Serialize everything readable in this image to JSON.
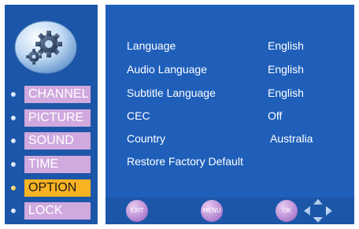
{
  "sidebar": {
    "items": [
      {
        "label": "CHANNEL",
        "active": false
      },
      {
        "label": "PICTURE",
        "active": false
      },
      {
        "label": "SOUND",
        "active": false
      },
      {
        "label": "TIME",
        "active": false
      },
      {
        "label": "OPTION",
        "active": true
      },
      {
        "label": "LOCK",
        "active": false
      }
    ]
  },
  "settings": [
    {
      "name": "Language",
      "value": "English"
    },
    {
      "name": "Audio Language",
      "value": "English"
    },
    {
      "name": "Subtitle Language",
      "value": "English"
    },
    {
      "name": "CEC",
      "value": "Off"
    },
    {
      "name": "Country",
      "value": "Australia"
    },
    {
      "name": "Restore Factory Default",
      "value": ""
    }
  ],
  "footer": {
    "exit_label": "EXIT",
    "menu_label": "MENU",
    "ok_label": "OK"
  },
  "colors": {
    "panel_bg": "#1f5fba",
    "frame_bg": "#1c56a8",
    "menu_item": "#d0a9de",
    "menu_active": "#f9b222"
  },
  "icons": {
    "logo": "gear-icon",
    "navigation": "dpad-arrows-icon"
  }
}
